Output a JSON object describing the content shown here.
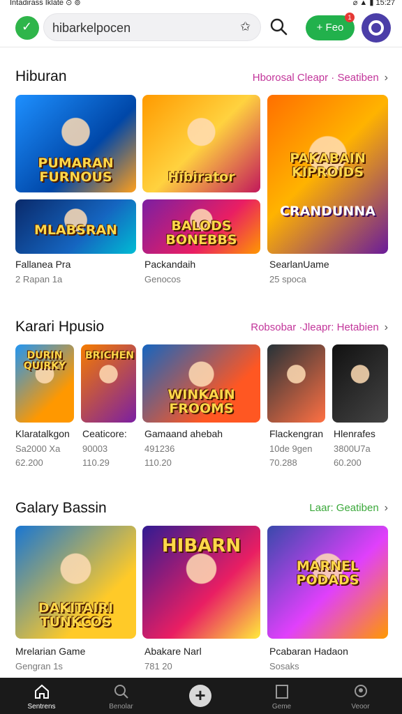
{
  "status_bar": {
    "left_text": "Intadirass Iklate  ⊙ ⊚",
    "right_text": "⌀ ▲ ▮ 15:27"
  },
  "header": {
    "search_text": "hibarkelpocen",
    "new_button_label": "+ Feo",
    "new_badge": "1"
  },
  "sections": [
    {
      "title": "Hiburan",
      "link": "Hborosal Cleapr · Seatiben",
      "link_color": "#c2359a",
      "items": [
        {
          "art": "PUMARAN FURNOUS",
          "label": "Fallanea Pra",
          "meta1": "2 Rapan 1a",
          "meta2": ""
        },
        {
          "art": "Hibirator",
          "label": "",
          "meta1": "",
          "meta2": ""
        },
        {
          "art": "PAKABAIN KIPROIDS",
          "label": "",
          "meta1": "",
          "meta2": ""
        },
        {
          "art": "MLABSRAN",
          "label": "",
          "meta1": "",
          "meta2": ""
        },
        {
          "art": "BALODS BONEBBS",
          "label": "Packandaih",
          "meta1": "Genocos",
          "meta2": ""
        },
        {
          "art": "CRANDUNNA",
          "label": "SearlanUame",
          "meta1": "25 spoca",
          "meta2": ""
        }
      ]
    },
    {
      "title": "Karari Hpusio",
      "link": "Robsobar ·Jleapr: Hetabien",
      "link_color": "#c2359a",
      "items": [
        {
          "art": "DURIN QUIRKY",
          "label": "Klaratalkgon",
          "meta1": "Sa2000 Xa",
          "meta2": "62.200"
        },
        {
          "art": "BRICHEN",
          "label": "Ceaticore:",
          "meta1": "90003",
          "meta2": "110.29"
        },
        {
          "art": "WINKAIN FROOMS",
          "label": "Gamaand ahebah",
          "meta1": "491236",
          "meta2": "110.20"
        },
        {
          "art": "",
          "label": "Flackengran",
          "meta1": "10de 9gen",
          "meta2": "70.288"
        },
        {
          "art": "",
          "label": "Hlenrafes",
          "meta1": "3800U7a",
          "meta2": "60.200"
        }
      ]
    },
    {
      "title": "Galary Bassin",
      "link": "Laar: Geatiben",
      "link_color": "#3aa83a",
      "items": [
        {
          "art": "DAKITAIRI TUNKCOS",
          "label": "Mrelarian Game",
          "meta1": "Gengran 1s",
          "meta2": ""
        },
        {
          "art": "HIBARN",
          "label": "Abakare Narl",
          "meta1": "781 20",
          "meta2": ""
        },
        {
          "art": "MARNEL PODADS",
          "label": "Pcabaran Hadaon",
          "meta1": "Sosaks",
          "meta2": ""
        }
      ]
    }
  ],
  "bottom_nav": [
    {
      "label": "Sentrens",
      "icon": "home-icon"
    },
    {
      "label": "Benolar",
      "icon": "search-icon"
    },
    {
      "label": "",
      "icon": "plus-icon"
    },
    {
      "label": "Geme",
      "icon": "square-icon"
    },
    {
      "label": "Veoor",
      "icon": "profile-icon"
    }
  ]
}
